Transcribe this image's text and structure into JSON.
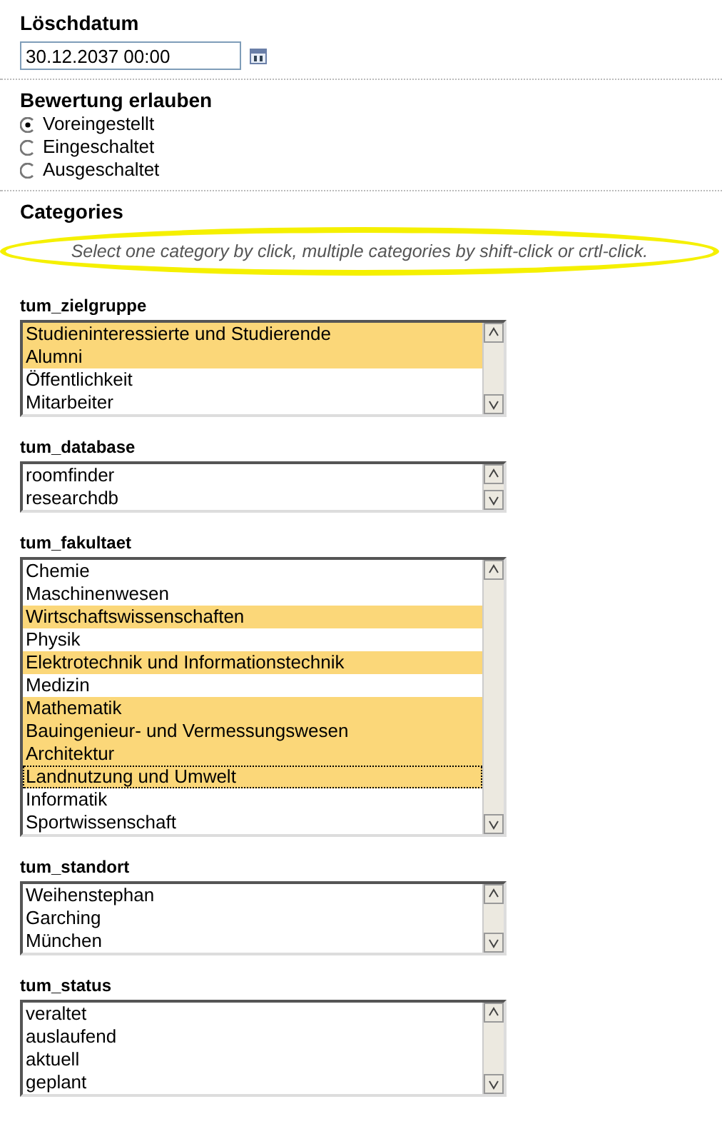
{
  "deletion_date": {
    "label": "Löschdatum",
    "value": "30.12.2037 00:00"
  },
  "rating": {
    "label": "Bewertung erlauben",
    "options": [
      {
        "label": "Voreingestellt",
        "selected": true
      },
      {
        "label": "Eingeschaltet",
        "selected": false
      },
      {
        "label": "Ausgeschaltet",
        "selected": false
      }
    ]
  },
  "categories": {
    "heading": "Categories",
    "hint": "Select one category by click, multiple categories by shift-click or crtl-click.",
    "hint_highlighted": true,
    "lists": [
      {
        "label": "tum_zielgruppe",
        "items": [
          {
            "text": "Studieninteressierte und Studierende",
            "selected": true
          },
          {
            "text": "Alumni",
            "selected": true
          },
          {
            "text": "Öffentlichkeit",
            "selected": false
          },
          {
            "text": "Mitarbeiter",
            "selected": false
          }
        ]
      },
      {
        "label": "tum_database",
        "items": [
          {
            "text": "roomfinder",
            "selected": false
          },
          {
            "text": "researchdb",
            "selected": false
          }
        ]
      },
      {
        "label": "tum_fakultaet",
        "items": [
          {
            "text": "Chemie",
            "selected": false,
            "focused": false
          },
          {
            "text": "Maschinenwesen",
            "selected": false,
            "focused": false
          },
          {
            "text": "Wirtschaftswissenschaften",
            "selected": true,
            "focused": false
          },
          {
            "text": "Physik",
            "selected": false,
            "focused": false
          },
          {
            "text": "Elektrotechnik und Informationstechnik",
            "selected": true,
            "focused": false
          },
          {
            "text": "Medizin",
            "selected": false,
            "focused": false
          },
          {
            "text": "Mathematik",
            "selected": true,
            "focused": false
          },
          {
            "text": "Bauingenieur- und Vermessungswesen",
            "selected": true,
            "focused": false
          },
          {
            "text": "Architektur",
            "selected": true,
            "focused": false
          },
          {
            "text": "Landnutzung und Umwelt",
            "selected": true,
            "focused": true
          },
          {
            "text": "Informatik",
            "selected": false,
            "focused": false
          },
          {
            "text": "Sportwissenschaft",
            "selected": false,
            "focused": false
          }
        ]
      },
      {
        "label": "tum_standort",
        "items": [
          {
            "text": "Weihenstephan",
            "selected": false
          },
          {
            "text": "Garching",
            "selected": false
          },
          {
            "text": "München",
            "selected": false
          }
        ]
      },
      {
        "label": "tum_status",
        "items": [
          {
            "text": "veraltet",
            "selected": false
          },
          {
            "text": "auslaufend",
            "selected": false
          },
          {
            "text": "aktuell",
            "selected": false
          },
          {
            "text": "geplant",
            "selected": false
          }
        ]
      }
    ]
  }
}
